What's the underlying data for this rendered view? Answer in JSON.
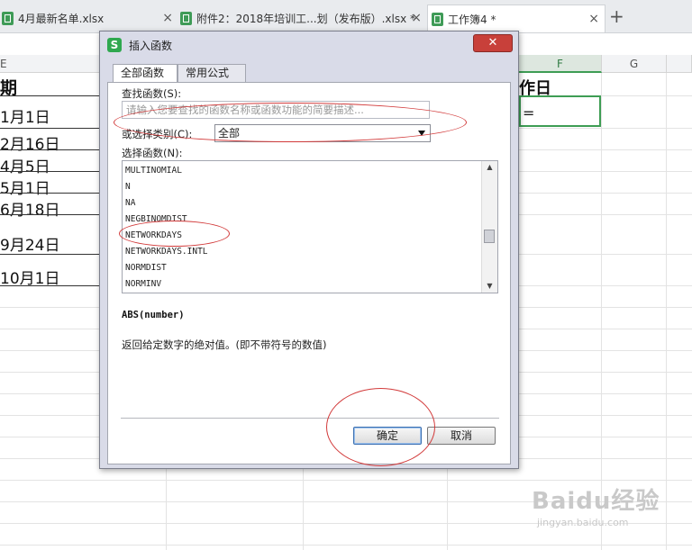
{
  "tabs": [
    {
      "label": "4月最新名单.xlsx",
      "close": "×"
    },
    {
      "label": "附件2：2018年培训工...划（发布版）.xlsx *",
      "close": "×"
    },
    {
      "label": "工作簿4 *",
      "close": "×"
    }
  ],
  "tab_plus": "+",
  "sheet": {
    "col_headers": {
      "left_partial": "E",
      "f": "F",
      "g": "G"
    },
    "header_qi": "期",
    "header_zuori": "作日",
    "selected_cell_value": "=",
    "dates": [
      "1月1日",
      "2月16日",
      "4月5日",
      "5月1日",
      "6月18日",
      "9月24日",
      "10月1日"
    ]
  },
  "dialog": {
    "title": "插入函数",
    "logo": "S",
    "close": "✕",
    "tabs": [
      "全部函数",
      "常用公式"
    ],
    "search_label": "查找函数(S):",
    "search_placeholder": "请输入您要查找的函数名称或函数功能的简要描述...",
    "category_label": "或选择类别(C):",
    "category_value": "全部",
    "function_label": "选择函数(N):",
    "functions": [
      "MULTINOMIAL",
      "N",
      "NA",
      "NEGBINOMDIST",
      "NETWORKDAYS",
      "NETWORKDAYS.INTL",
      "NORMDIST",
      "NORMINV"
    ],
    "signature": "ABS(number)",
    "description": "返回给定数字的绝对值。(即不带符号的数值)",
    "ok_label": "确定",
    "cancel_label": "取消"
  },
  "watermark": {
    "main": "Baidu经验",
    "sub": "jingyan.baidu.com"
  },
  "colors": {
    "accent_green": "#3e9d54",
    "annotation_red": "#d23a3a",
    "close_red": "#c8403a"
  }
}
